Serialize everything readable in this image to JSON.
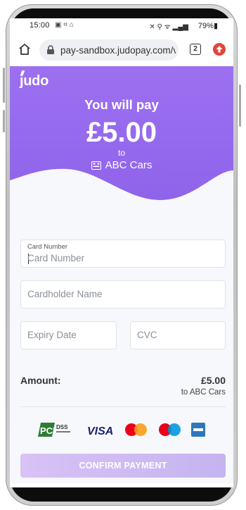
{
  "status_bar": {
    "time": "15:00",
    "battery": "79%"
  },
  "browser": {
    "url": "pay-sandbox.judopay.com/v",
    "tab_count": "2"
  },
  "header": {
    "logo": "judo",
    "pay_label": "You will pay",
    "amount": "£5.00",
    "to_label": "to",
    "merchant": "ABC Cars"
  },
  "form": {
    "card_number_label": "Card Number",
    "card_number_placeholder": "Card Number",
    "cardholder_placeholder": "Cardholder Name",
    "expiry_placeholder": "Expiry Date",
    "cvc_placeholder": "CVC"
  },
  "summary": {
    "amount_label": "Amount:",
    "amount_value": "£5.00",
    "to_merchant": "to ABC Cars"
  },
  "payment_logos": [
    "pci-dss-logo",
    "visa-logo",
    "mastercard-logo",
    "maestro-logo",
    "amex-logo"
  ],
  "pci_text": "PCI",
  "pci_dss": "DSS",
  "visa_text": "VISA",
  "confirm_button": "CONFIRM PAYMENT",
  "colors": {
    "brand_purple": "#9a6ff0",
    "button": "#d1bef5",
    "error_badge": "#e0463b"
  }
}
